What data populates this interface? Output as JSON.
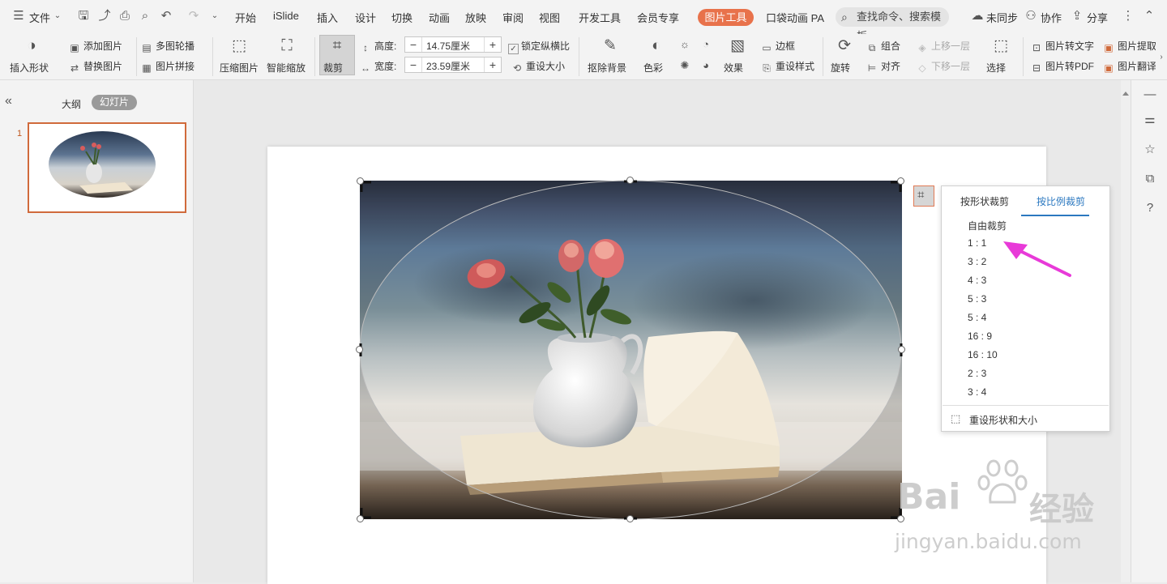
{
  "menubar": {
    "file": "文件",
    "tabs": [
      "开始",
      "iSlide",
      "插入",
      "设计",
      "切换",
      "动画",
      "放映",
      "审阅",
      "视图",
      "开发工具",
      "会员专享"
    ],
    "picture_tools": "图片工具",
    "pocket_anim": "口袋动画 PA",
    "search": "查找命令、搜索模板",
    "unsynced": "未同步",
    "collab": "协作",
    "share": "分享"
  },
  "ribbon": {
    "insert_shape": "插入形状",
    "add_picture": "添加图片",
    "replace_picture": "替换图片",
    "multi_carousel": "多图轮播",
    "picture_stitch": "图片拼接",
    "compress": "压缩图片",
    "smart_zoom": "智能缩放",
    "crop": "裁剪",
    "height_label": "高度:",
    "height_value": "14.75厘米",
    "width_label": "宽度:",
    "width_value": "23.59厘米",
    "lock_ratio": "锁定纵横比",
    "reset_size": "重设大小",
    "remove_bg": "抠除背景",
    "color": "色彩",
    "effects": "效果",
    "border": "边框",
    "reset_style": "重设样式",
    "rotate": "旋转",
    "group": "组合",
    "align": "对齐",
    "bring_forward": "上移一层",
    "send_backward": "下移一层",
    "select": "选择",
    "to_text": "图片转文字",
    "to_pdf": "图片转PDF",
    "extract": "图片提取",
    "translate": "图片翻译"
  },
  "left_panel": {
    "outline_tab": "大纲",
    "slides_tab": "幻灯片",
    "slide_number": "1"
  },
  "crop_menu": {
    "tab_shape": "按形状裁剪",
    "tab_ratio": "按比例裁剪",
    "options": [
      "自由裁剪",
      "1 : 1",
      "3 : 2",
      "4 : 3",
      "5 : 3",
      "5 : 4",
      "16 : 9",
      "16 : 10",
      "2 : 3",
      "3 : 4"
    ],
    "reset": "重设形状和大小"
  },
  "watermark": {
    "brand": "Bai",
    "brand_cn": "经验",
    "url": "jingyan.baidu.com"
  },
  "colors": {
    "accent": "#e8724b",
    "link_blue": "#2b78c0",
    "arrow": "#e83ad8"
  }
}
